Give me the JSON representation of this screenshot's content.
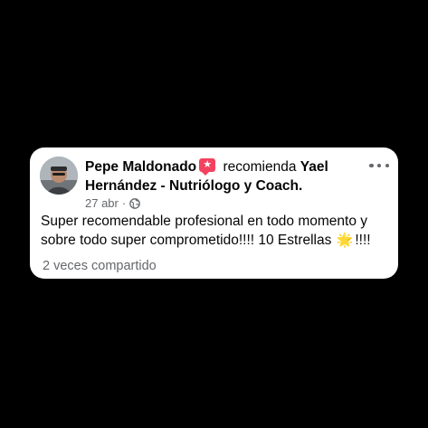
{
  "post": {
    "author": "Pepe Maldonado",
    "recommend_icon": "recommendation-badge-icon",
    "recommend_glyph": "★",
    "verb": "recomienda",
    "target_name": "Yael Hernández - Nutriólogo y Coach.",
    "date": "27 abr",
    "separator": "·",
    "privacy_icon": "globe-icon",
    "body_text": "Super recomendable profesional en todo momento y sobre todo super comprometido!!!! 10 Estrellas",
    "star_emoji": "🌟",
    "body_suffix": "!!!!",
    "shares": "2 veces compartido"
  },
  "colors": {
    "background": "#000000",
    "card": "#ffffff",
    "text_primary": "#050505",
    "text_secondary": "#65676b",
    "recommend_badge": "#f3425f",
    "star": "#f7c31d"
  }
}
